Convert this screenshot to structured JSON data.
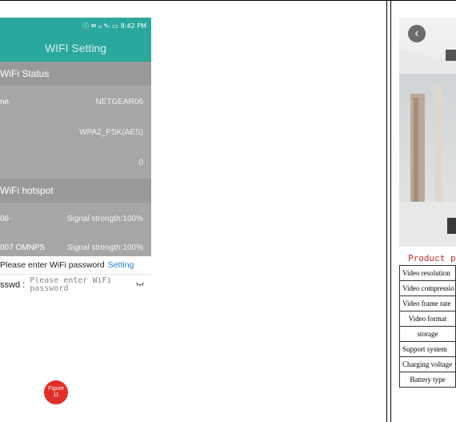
{
  "phone": {
    "status_bar": {
      "icons": "ⓘ ✉ ᵢₗₗ ✎ᵢ ▭",
      "time": "8:42 PM"
    },
    "app_title": "WIFI Setting",
    "wifi_status_header": "WiFi Status",
    "status_rows": [
      {
        "label": "ne",
        "value": "NETGEAR06"
      },
      {
        "label": "",
        "value": "WPA2_PSK(AES)"
      },
      {
        "label": "",
        "value": "0"
      }
    ],
    "hotspot_header": "WiFi hotspot",
    "hotspot_rows": [
      {
        "label": "06",
        "value": "Signal strength:100%"
      },
      {
        "label": "007 OMNPS",
        "value": "Signal strength:100%"
      }
    ],
    "dialog": {
      "prompt": "Please enter WiFi password",
      "setting_link": "Setting",
      "field_label": "sswd :",
      "placeholder": "Please enter WiFi password"
    }
  },
  "figure_badge": {
    "line1": "Figure",
    "line2": "11"
  },
  "product": {
    "title": "Product pa",
    "back_icon": "chevron-left-icon",
    "spec_rows": [
      "Video resolution",
      "Video compressio",
      "Video frame rate",
      "Video format",
      "storage",
      "Support system",
      "Charging voltage",
      "Battery type"
    ]
  },
  "colors": {
    "app_bar": "#2aa89d",
    "setting_link": "#1e7fd1",
    "product_title": "#cc2b2b",
    "badge": "#e02f26"
  }
}
